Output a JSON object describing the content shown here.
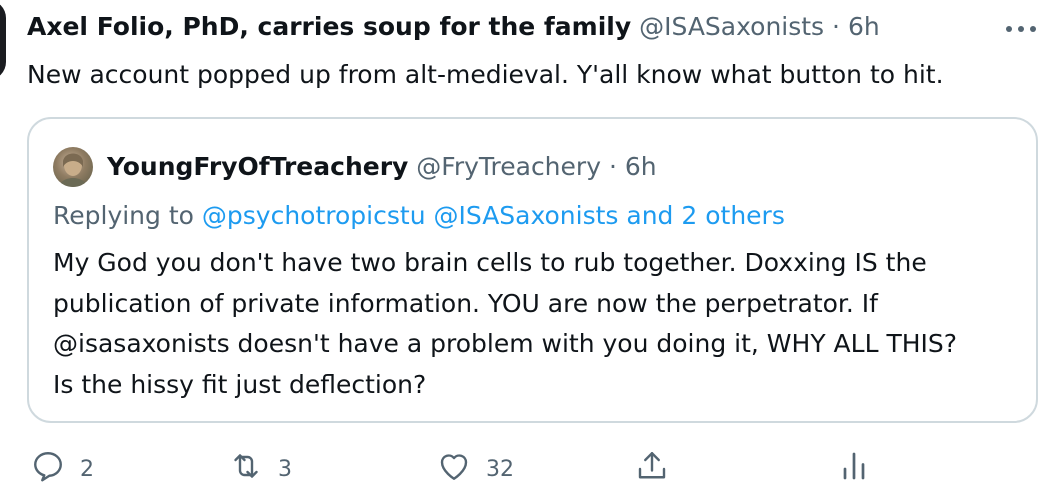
{
  "tweet": {
    "display_name": "Axel Folio, PhD, carries soup for the family",
    "handle": "@ISASaxonists",
    "separator": "·",
    "time": "6h",
    "text": "New account popped up from alt-medieval. Y'all know what button to hit."
  },
  "quote": {
    "display_name": "YoungFryOfTreachery",
    "handle": "@FryTreachery",
    "separator": "·",
    "time": "6h",
    "replying_prefix": "Replying to",
    "replying_mentions": "@psychotropicstu @ISASaxonists and 2 others",
    "body_lines": [
      "My God you don't have two brain cells to rub together. Doxxing IS the",
      "publication of private information. YOU are now the perpetrator. If",
      "@isasaxonists doesn't have a problem with you doing it, WHY ALL THIS?",
      "Is the hissy fit just deflection?"
    ]
  },
  "actions": {
    "reply_count": "2",
    "retweet_count": "3",
    "like_count": "32"
  },
  "colors": {
    "text": "#0f1419",
    "muted": "#536471",
    "link": "#1d9bf0",
    "border": "#cfd9de"
  },
  "icons": [
    "more-icon",
    "reply-icon",
    "retweet-icon",
    "like-icon",
    "share-icon",
    "analytics-icon"
  ]
}
